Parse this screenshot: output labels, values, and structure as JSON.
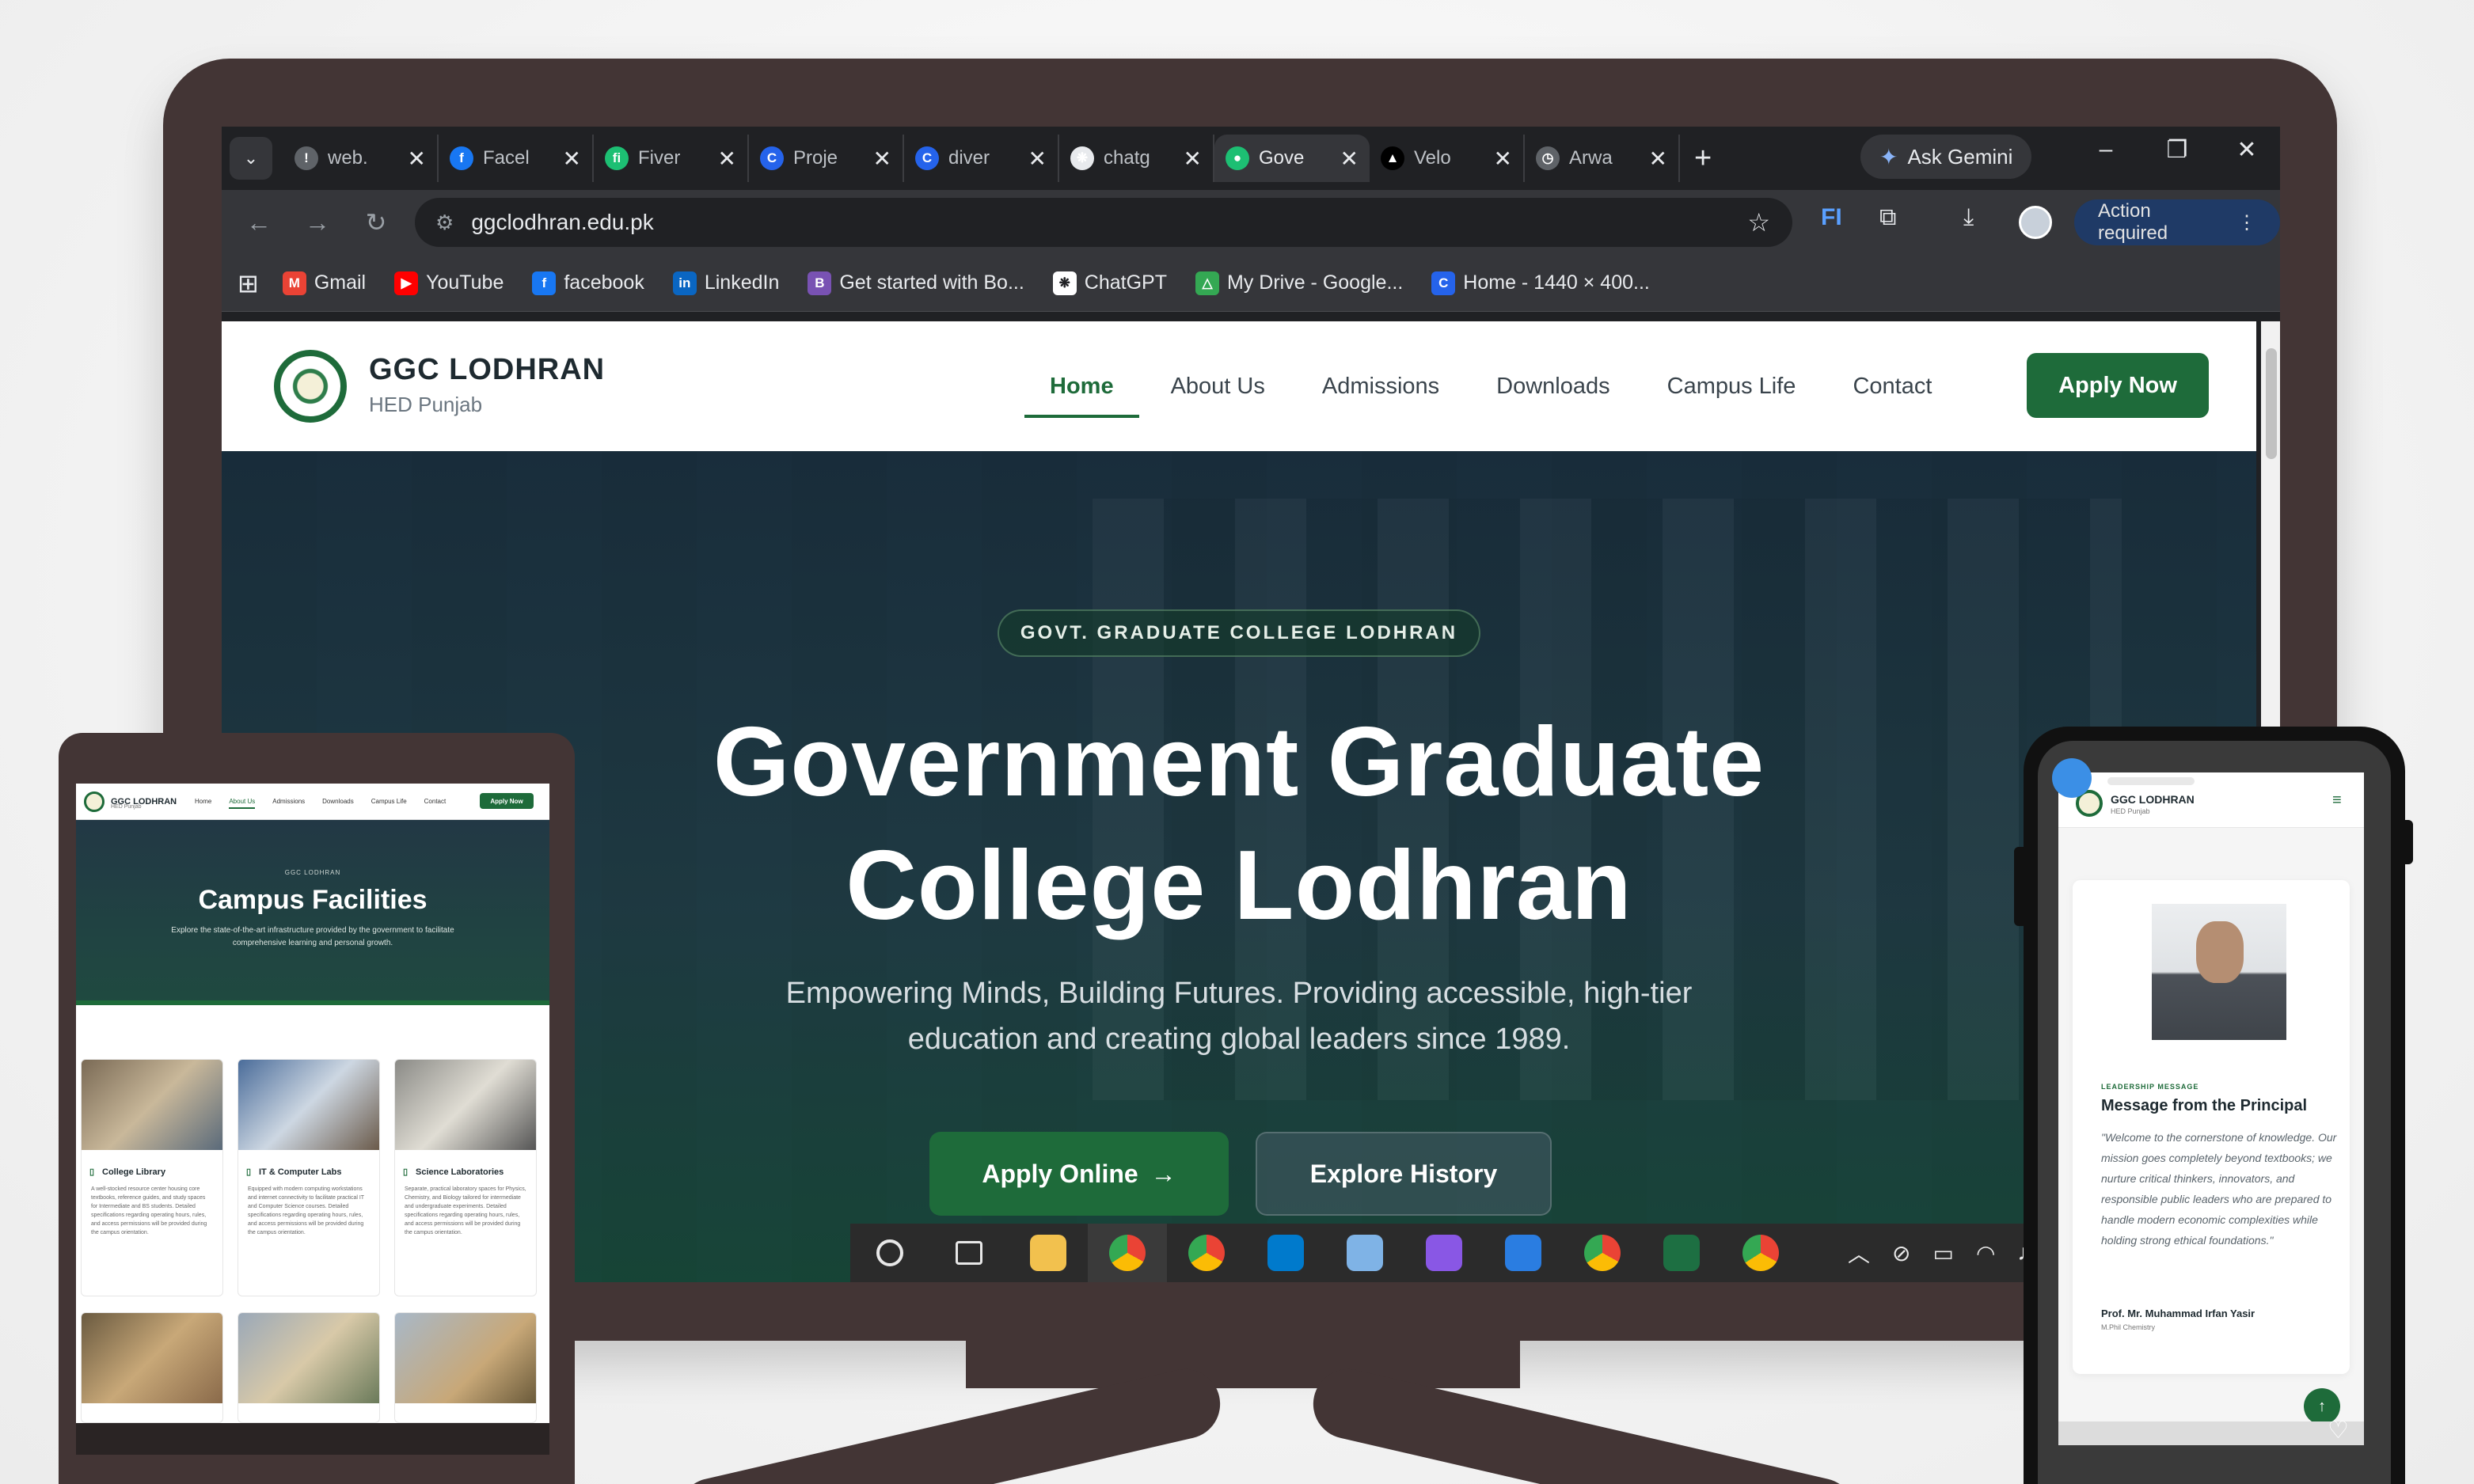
{
  "browser": {
    "tabs": [
      {
        "label": "web.",
        "icon": "warning-icon",
        "color": "#5f6368"
      },
      {
        "label": "Facel",
        "icon": "facebook-icon",
        "color": "#1877f2"
      },
      {
        "label": "Fiver",
        "icon": "fiverr-icon",
        "color": "#1dbf73"
      },
      {
        "label": "Proje",
        "icon": "canva-icon",
        "color": "#2563eb"
      },
      {
        "label": "diver",
        "icon": "canva-icon",
        "color": "#2563eb"
      },
      {
        "label": "chatg",
        "icon": "chatgpt-icon",
        "color": "#e8eaed"
      },
      {
        "label": "Gove",
        "icon": "site-icon",
        "color": "#1dbf73",
        "active": true
      },
      {
        "label": "Velo",
        "icon": "vercel-icon",
        "color": "#000000"
      },
      {
        "label": "Arwa",
        "icon": "timer-icon",
        "color": "#5f6368"
      }
    ],
    "gemini_label": "Ask Gemini",
    "url": "ggclodhran.edu.pk",
    "action_label": "Action required",
    "bookmarks": [
      {
        "label": "Gmail",
        "icon": "gmail-icon",
        "color": "#ea4335"
      },
      {
        "label": "YouTube",
        "icon": "youtube-icon",
        "color": "#ff0000"
      },
      {
        "label": "facebook",
        "icon": "facebook-icon",
        "color": "#1877f2"
      },
      {
        "label": "LinkedIn",
        "icon": "linkedin-icon",
        "color": "#0a66c2"
      },
      {
        "label": "Get started with Bo...",
        "icon": "bootstrap-icon",
        "color": "#7952b3"
      },
      {
        "label": "ChatGPT",
        "icon": "chatgpt-icon",
        "color": "#ffffff"
      },
      {
        "label": "My Drive - Google...",
        "icon": "drive-icon",
        "color": "#34a853"
      },
      {
        "label": "Home - 1440 × 400...",
        "icon": "canva-icon",
        "color": "#2563eb"
      }
    ]
  },
  "site": {
    "name": "GGC LODHRAN",
    "sub": "HED Punjab",
    "nav": [
      "Home",
      "About Us",
      "Admissions",
      "Downloads",
      "Campus Life",
      "Contact"
    ],
    "apply_label": "Apply Now",
    "accent": "#1e6b3a",
    "hero": {
      "kicker": "GOVT. GRADUATE COLLEGE LODHRAN",
      "title_line1": "Government Graduate",
      "title_line2": "College Lodhran",
      "subtitle_line1": "Empowering Minds, Building Futures. Providing accessible, high-tier",
      "subtitle_line2": "education and creating global leaders since 1989.",
      "primary_label": "Apply Online",
      "secondary_label": "Explore History"
    }
  },
  "tablet": {
    "name": "GGC LODHRAN",
    "sub": "HED Punjab",
    "nav": [
      "Home",
      "About Us",
      "Admissions",
      "Downloads",
      "Campus Life",
      "Contact"
    ],
    "apply_label": "Apply Now",
    "kicker": "GGC LODHRAN",
    "title": "Campus Facilities",
    "desc": "Explore the state-of-the-art infrastructure provided by the government to facilitate comprehensive learning and personal growth.",
    "cards": [
      {
        "title": "College Library",
        "desc": "A well-stocked resource center housing core textbooks, reference guides, and study spaces for Intermediate and BS students. Detailed specifications regarding operating hours, rules, and access permissions will be provided during the campus orientation."
      },
      {
        "title": "IT & Computer Labs",
        "desc": "Equipped with modern computing workstations and internet connectivity to facilitate practical IT and Computer Science courses. Detailed specifications regarding operating hours, rules, and access permissions will be provided during the campus orientation."
      },
      {
        "title": "Science Laboratories",
        "desc": "Separate, practical laboratory spaces for Physics, Chemistry, and Biology tailored for intermediate and undergraduate experiments. Detailed specifications regarding operating hours, rules, and access permissions will be provided during the campus orientation."
      }
    ]
  },
  "phone": {
    "name": "GGC LODHRAN",
    "sub": "HED Punjab",
    "kicker": "LEADERSHIP MESSAGE",
    "title": "Message from the Principal",
    "quote": "\"Welcome to the cornerstone of knowledge. Our mission goes completely beyond textbooks; we nurture critical thinkers, innovators, and responsible public leaders who are prepared to handle modern economic complexities while holding strong ethical foundations.\"",
    "author": "Prof. Mr. Muhammad Irfan Yasir",
    "role": "M.Phil Chemistry"
  },
  "taskbar": {
    "apps": [
      {
        "icon": "search-circle-icon",
        "color": "#2b2b2b"
      },
      {
        "icon": "task-view-icon",
        "color": "#2b2b2b"
      },
      {
        "icon": "file-explorer-icon",
        "color": "#f2c14e"
      },
      {
        "icon": "chrome-profile-icon",
        "color": "#4285f4",
        "selected": true
      },
      {
        "icon": "chrome-icon",
        "color": "#4285f4"
      },
      {
        "icon": "vscode-icon",
        "color": "#007acc"
      },
      {
        "icon": "notepad-icon",
        "color": "#7fb3e6"
      },
      {
        "icon": "github-icon",
        "color": "#8957e5"
      },
      {
        "icon": "photos-icon",
        "color": "#2a7de1"
      },
      {
        "icon": "chrome-icon",
        "color": "#4285f4"
      },
      {
        "icon": "excel-icon",
        "color": "#1d6f42"
      },
      {
        "icon": "chrome-profile-icon",
        "color": "#4285f4"
      }
    ]
  }
}
